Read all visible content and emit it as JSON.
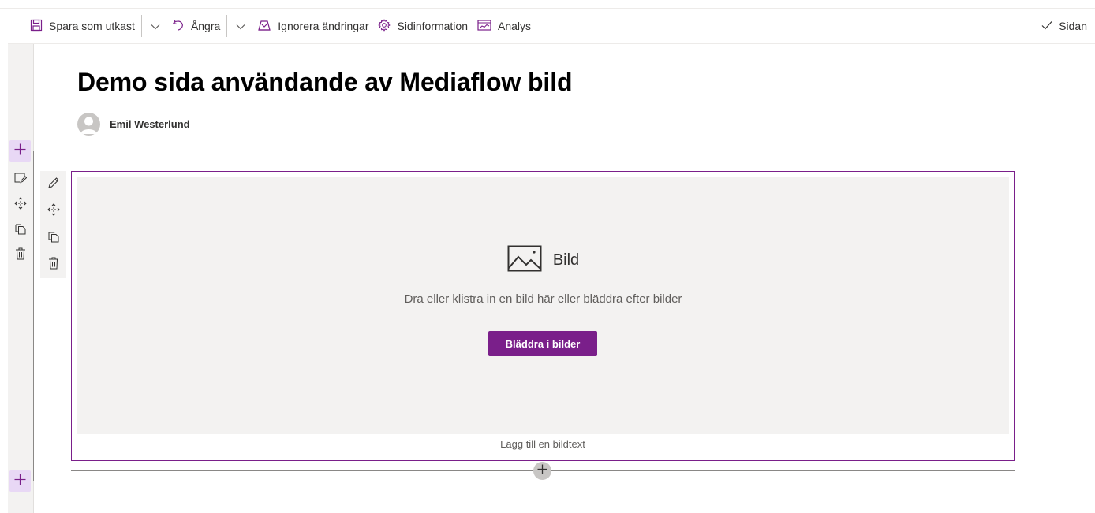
{
  "toolbar": {
    "save_draft_label": "Spara som utkast",
    "undo_label": "Ångra",
    "discard_label": "Ignorera ändringar",
    "page_details_label": "Sidinformation",
    "analytics_label": "Analys",
    "publish_label": "Sidan"
  },
  "page": {
    "title": "Demo sida användande av Mediaflow bild",
    "author": "Emil Westerlund"
  },
  "image_webpart": {
    "title": "Bild",
    "description": "Dra eller klistra in en bild här eller bläddra efter bilder",
    "browse_button": "Bläddra i bilder",
    "caption_placeholder": "Lägg till en bildtext"
  },
  "colors": {
    "accent": "#7a1f8a",
    "add_section_bg": "#e8d8f5",
    "placeholder_bg": "#f3f2f1"
  }
}
